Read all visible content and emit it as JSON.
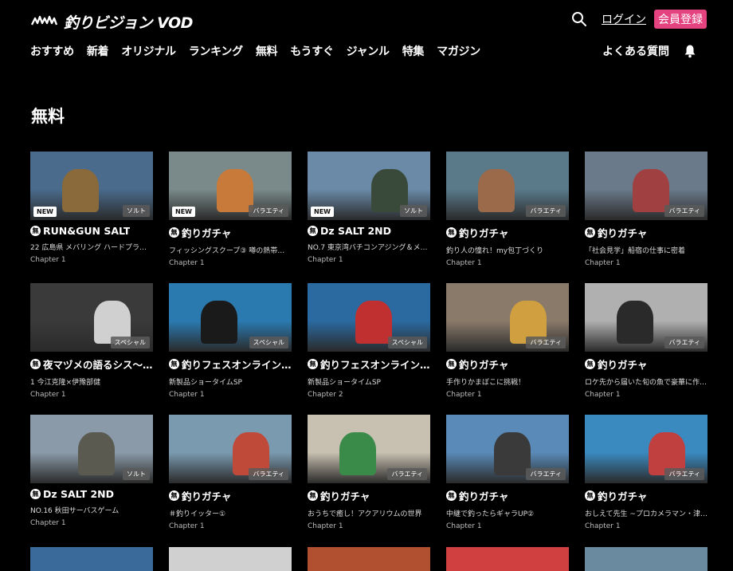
{
  "header": {
    "logo_text": "釣りビジョン VOD",
    "login_label": "ログイン",
    "signup_label": "会員登録",
    "faq_label": "よくある質問"
  },
  "nav": {
    "items": [
      "おすすめ",
      "新着",
      "オリジナル",
      "ランキング",
      "無料",
      "もうすぐ",
      "ジャンル",
      "特集",
      "マガジン"
    ]
  },
  "page": {
    "title": "無料"
  },
  "free_icon_label": "無",
  "cards": [
    {
      "title": "RUN&GUN SALT",
      "subtitle": "22 広島県 メバリング ハードプラ…",
      "chapter": "Chapter 1",
      "genre": "ソルト",
      "new": "NEW",
      "bg": "#4a6b8c",
      "accent": "#8a6a3a"
    },
    {
      "title": "釣りガチャ",
      "subtitle": "フィッシングスクープ③ 噂の熱帯魚…",
      "chapter": "Chapter 1",
      "genre": "バラエティ",
      "new": "NEW",
      "bg": "#7a8a8a",
      "accent": "#c77a3a"
    },
    {
      "title": "Dz SALT 2ND",
      "subtitle": "NO.7 東京湾バチコンアジング＆メ…",
      "chapter": "Chapter 1",
      "genre": "ソルト",
      "new": "NEW",
      "bg": "#6a8aa8",
      "accent": "#3a4a3a"
    },
    {
      "title": "釣りガチャ",
      "subtitle": "釣り人の憧れ！my包丁づくり",
      "chapter": "Chapter 1",
      "genre": "バラエティ",
      "new": "",
      "bg": "#5a7a8a",
      "accent": "#9a6a4a"
    },
    {
      "title": "釣りガチャ",
      "subtitle": "「社会見学」船宿の仕事に密着",
      "chapter": "Chapter 1",
      "genre": "バラエティ",
      "new": "",
      "bg": "#6a7a8a",
      "accent": "#a04040"
    },
    {
      "title": "夜マヅメの語るシス〜…",
      "subtitle": "1 今江克隆×伊豫部健",
      "chapter": "Chapter 1",
      "genre": "スペシャル",
      "new": "",
      "bg": "#3a3a3a",
      "accent": "#d0d0d0"
    },
    {
      "title": "釣りフェスオンライン…",
      "subtitle": "新製品ショータイムSP",
      "chapter": "Chapter 1",
      "genre": "スペシャル",
      "new": "",
      "bg": "#2a7ab0",
      "accent": "#1a1a1a"
    },
    {
      "title": "釣りフェスオンライン…",
      "subtitle": "新製品ショータイムSP",
      "chapter": "Chapter 2",
      "genre": "スペシャル",
      "new": "",
      "bg": "#2a6aa0",
      "accent": "#c03030"
    },
    {
      "title": "釣りガチャ",
      "subtitle": "手作りかまぼこに挑戦！",
      "chapter": "Chapter 1",
      "genre": "バラエティ",
      "new": "",
      "bg": "#8a7a6a",
      "accent": "#d0a040"
    },
    {
      "title": "釣りガチャ",
      "subtitle": "ロケ先から届いた旬の魚で豪華に作…",
      "chapter": "Chapter 1",
      "genre": "バラエティ",
      "new": "",
      "bg": "#b0b0b0",
      "accent": "#2a2a2a"
    },
    {
      "title": "Dz SALT 2ND",
      "subtitle": "NO.16 秋田サーバスゲーム",
      "chapter": "Chapter 1",
      "genre": "ソルト",
      "new": "",
      "bg": "#8a9aa8",
      "accent": "#5a5a50"
    },
    {
      "title": "釣りガチャ",
      "subtitle": "＃釣りイッター①",
      "chapter": "Chapter 1",
      "genre": "バラエティ",
      "new": "",
      "bg": "#7a9ab0",
      "accent": "#c04a3a"
    },
    {
      "title": "釣りガチャ",
      "subtitle": "おうちで癒し！アクアリウムの世界",
      "chapter": "Chapter 1",
      "genre": "バラエティ",
      "new": "",
      "bg": "#c8c0b0",
      "accent": "#3a8a4a"
    },
    {
      "title": "釣りガチャ",
      "subtitle": "中継で釣ったらギャラUP②",
      "chapter": "Chapter 1",
      "genre": "バラエティ",
      "new": "",
      "bg": "#5a8ab8",
      "accent": "#3a3a3a"
    },
    {
      "title": "釣りガチャ",
      "subtitle": "おしえて先生 ~プロカメラマン・津…",
      "chapter": "Chapter 1",
      "genre": "バラエティ",
      "new": "",
      "bg": "#3a8ac0",
      "accent": "#c04040"
    }
  ],
  "peek_cards": [
    {
      "bg": "#3a6a9a"
    },
    {
      "bg": "#d0d0d0"
    },
    {
      "bg": "#b05030"
    },
    {
      "bg": "#d04040"
    },
    {
      "bg": "#6a8aa0"
    }
  ]
}
